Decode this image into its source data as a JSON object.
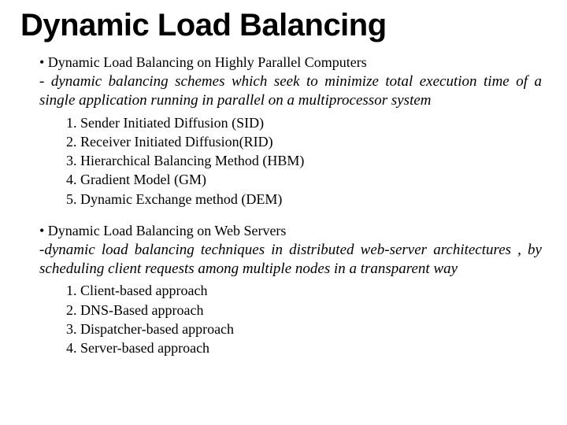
{
  "title": "Dynamic Load Balancing",
  "section1": {
    "bullet": "• Dynamic Load Balancing on Highly Parallel Computers",
    "desc": "- dynamic balancing schemes which seek to minimize total execution time of a single application running in parallel on a multiprocessor system",
    "items": {
      "i1": "1. Sender Initiated Diffusion (SID)",
      "i2": "2. Receiver Initiated Diffusion(RID)",
      "i3": "3. Hierarchical Balancing Method (HBM)",
      "i4": "4. Gradient Model (GM)",
      "i5": "5. Dynamic Exchange method (DEM)"
    }
  },
  "section2": {
    "bullet": "• Dynamic Load Balancing on Web Servers",
    "desc": "-dynamic load balancing techniques in distributed web-server architectures , by scheduling client requests among multiple nodes in a transparent way",
    "items": {
      "i1": "1. Client-based approach",
      "i2": "2. DNS-Based approach",
      "i3": "3. Dispatcher-based approach",
      "i4": "4. Server-based approach"
    }
  }
}
